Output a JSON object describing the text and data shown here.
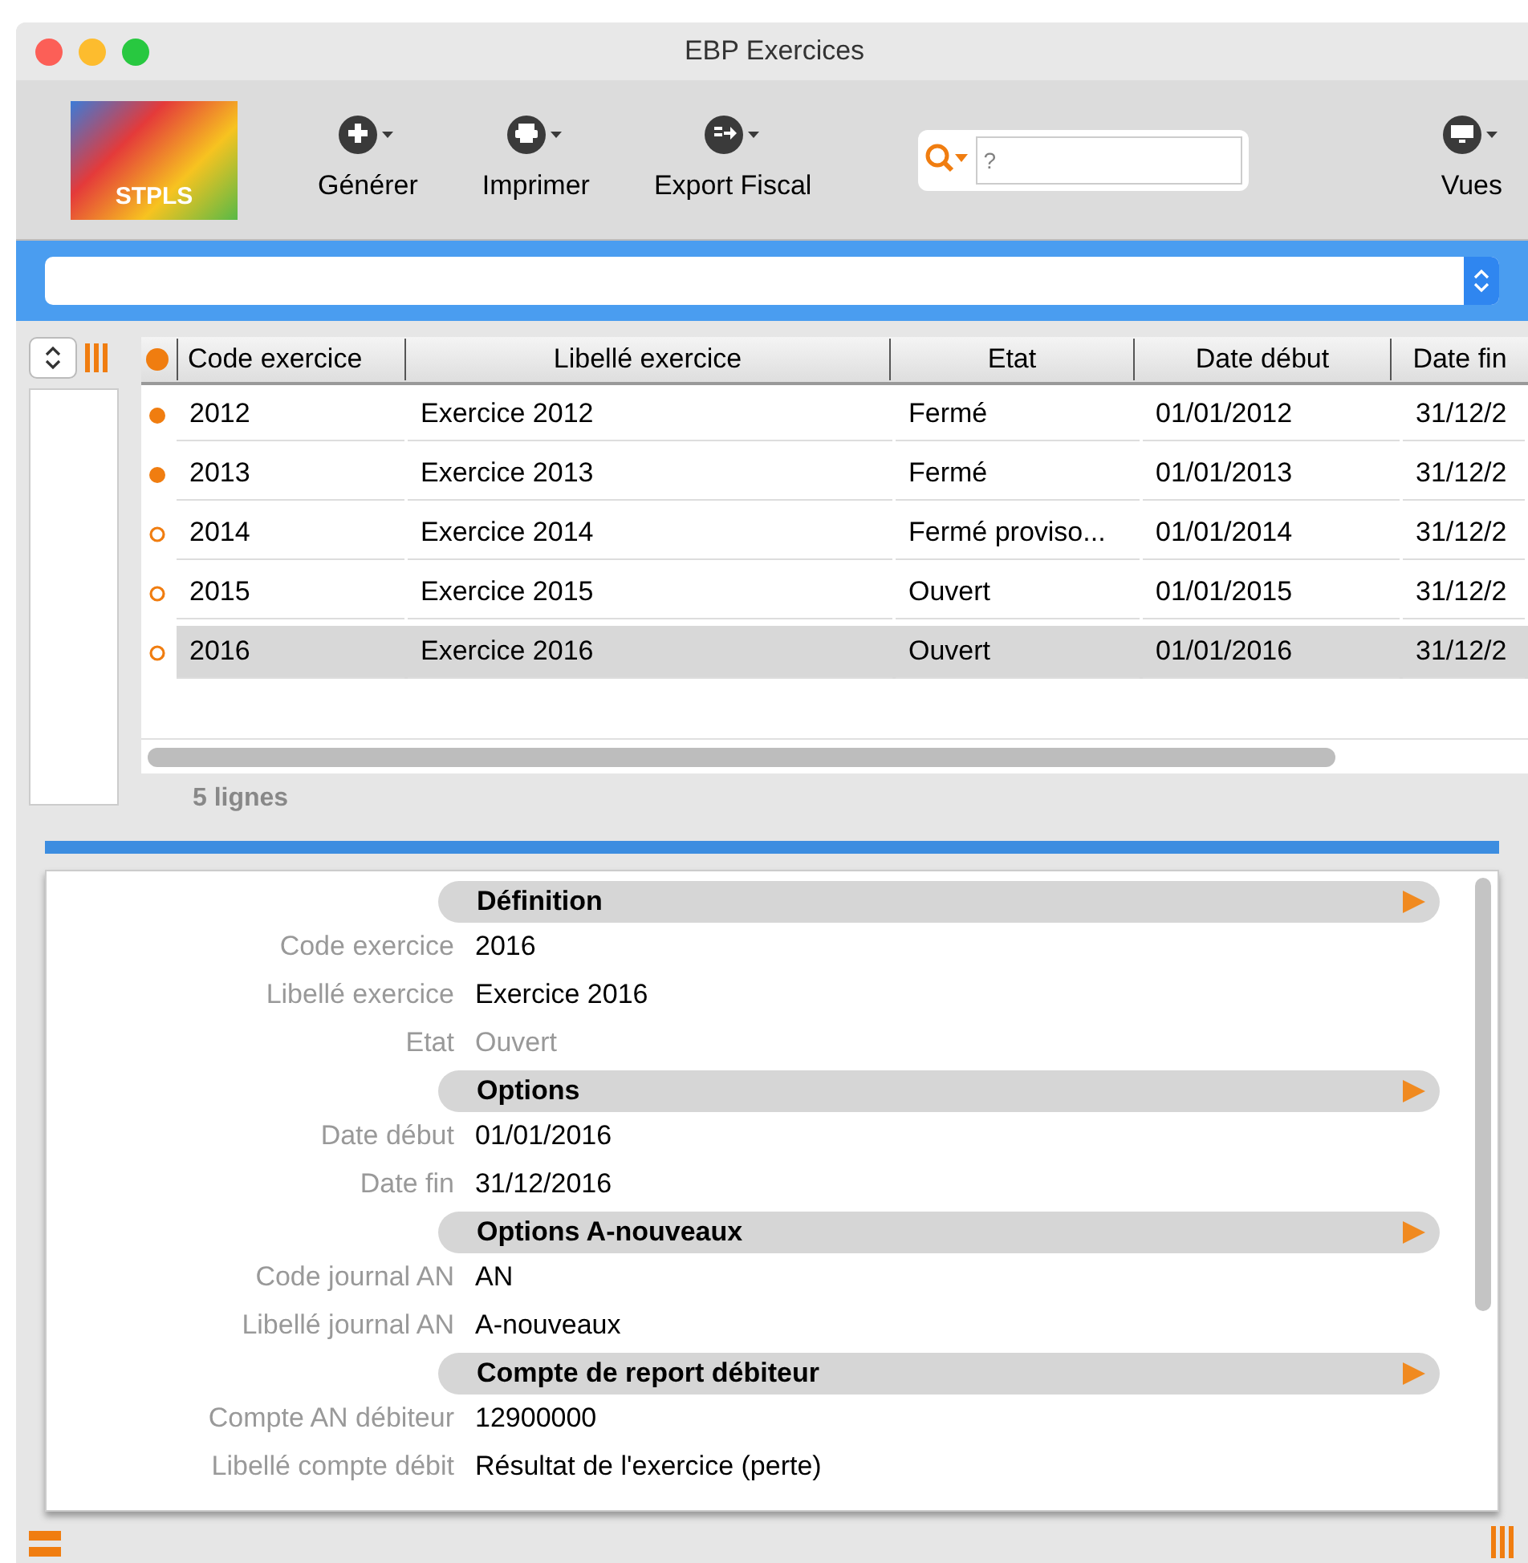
{
  "window": {
    "title": "EBP Exercices"
  },
  "toolbar": {
    "logo_text": "STPLS",
    "buttons": [
      {
        "label": "Générer",
        "kind": "add"
      },
      {
        "label": "Imprimer",
        "kind": "print"
      },
      {
        "label": "Export Fiscal",
        "kind": "export"
      }
    ],
    "search": {
      "placeholder": "?"
    },
    "views": {
      "label": "Vues"
    }
  },
  "table": {
    "columns": [
      "Code exercice",
      "Libellé exercice",
      "Etat",
      "Date début",
      "Date fin"
    ],
    "rows": [
      {
        "filled": true,
        "selected": false,
        "cells": [
          "2012",
          "Exercice 2012",
          "Fermé",
          "01/01/2012",
          "31/12/2"
        ]
      },
      {
        "filled": true,
        "selected": false,
        "cells": [
          "2013",
          "Exercice 2013",
          "Fermé",
          "01/01/2013",
          "31/12/2"
        ]
      },
      {
        "filled": false,
        "selected": false,
        "cells": [
          "2014",
          "Exercice 2014",
          "Fermé proviso...",
          "01/01/2014",
          "31/12/2"
        ]
      },
      {
        "filled": false,
        "selected": false,
        "cells": [
          "2015",
          "Exercice 2015",
          "Ouvert",
          "01/01/2015",
          "31/12/2"
        ]
      },
      {
        "filled": false,
        "selected": true,
        "cells": [
          "2016",
          "Exercice 2016",
          "Ouvert",
          "01/01/2016",
          "31/12/2"
        ]
      }
    ],
    "count": "5 lignes"
  },
  "detail": {
    "sections": [
      {
        "title": "Définition",
        "fields": [
          {
            "label": "Code exercice",
            "value": "2016",
            "disabled": false
          },
          {
            "label": "Libellé exercice",
            "value": "Exercice 2016",
            "disabled": false
          },
          {
            "label": "Etat",
            "value": "Ouvert",
            "disabled": true
          }
        ]
      },
      {
        "title": "Options",
        "fields": [
          {
            "label": "Date début",
            "value": "01/01/2016",
            "disabled": false
          },
          {
            "label": "Date fin",
            "value": "31/12/2016",
            "disabled": false
          }
        ]
      },
      {
        "title": "Options A-nouveaux",
        "fields": [
          {
            "label": "Code journal AN",
            "value": "AN",
            "disabled": false
          },
          {
            "label": "Libellé journal AN",
            "value": "A-nouveaux",
            "disabled": false
          }
        ]
      },
      {
        "title": "Compte de report débiteur",
        "fields": [
          {
            "label": "Compte AN débiteur",
            "value": "12900000",
            "disabled": false
          },
          {
            "label": "Libellé compte débit",
            "value": "Résultat de l'exercice (perte)",
            "disabled": false
          }
        ]
      }
    ]
  }
}
